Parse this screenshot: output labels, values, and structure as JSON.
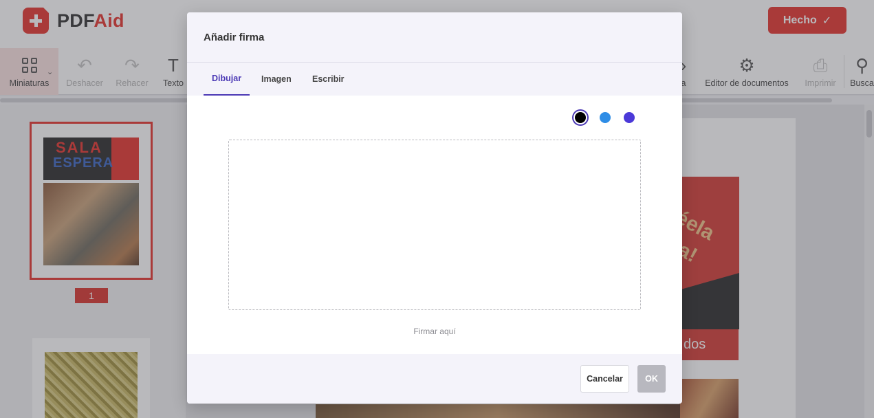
{
  "app": {
    "logo_prefix": "PDF",
    "logo_suffix": "Aid",
    "done_label": "Hecho",
    "done_icon": "✓"
  },
  "toolbar": {
    "thumbnails": "Miniaturas",
    "undo": "Deshacer",
    "redo": "Rehacer",
    "text": "Texto",
    "partial_label": "a",
    "doc_editor": "Editor de documentos",
    "print": "Imprimir",
    "search": "Busca"
  },
  "sidebar": {
    "page_number": "1"
  },
  "document": {
    "poster_text": "éela\nala!",
    "band_text": "dos"
  },
  "colors": {
    "accent": "#e5322d",
    "modal_accent": "#4b39b5",
    "swatches": [
      "#000000",
      "#2e8de6",
      "#4b39d8"
    ]
  },
  "modal": {
    "title": "Añadir firma",
    "tabs": [
      {
        "label": "Dibujar",
        "active": true
      },
      {
        "label": "Imagen",
        "active": false
      },
      {
        "label": "Escribir",
        "active": false
      }
    ],
    "selected_color_index": 0,
    "sign_hint": "Firmar aquí",
    "cancel_label": "Cancelar",
    "ok_label": "OK"
  }
}
